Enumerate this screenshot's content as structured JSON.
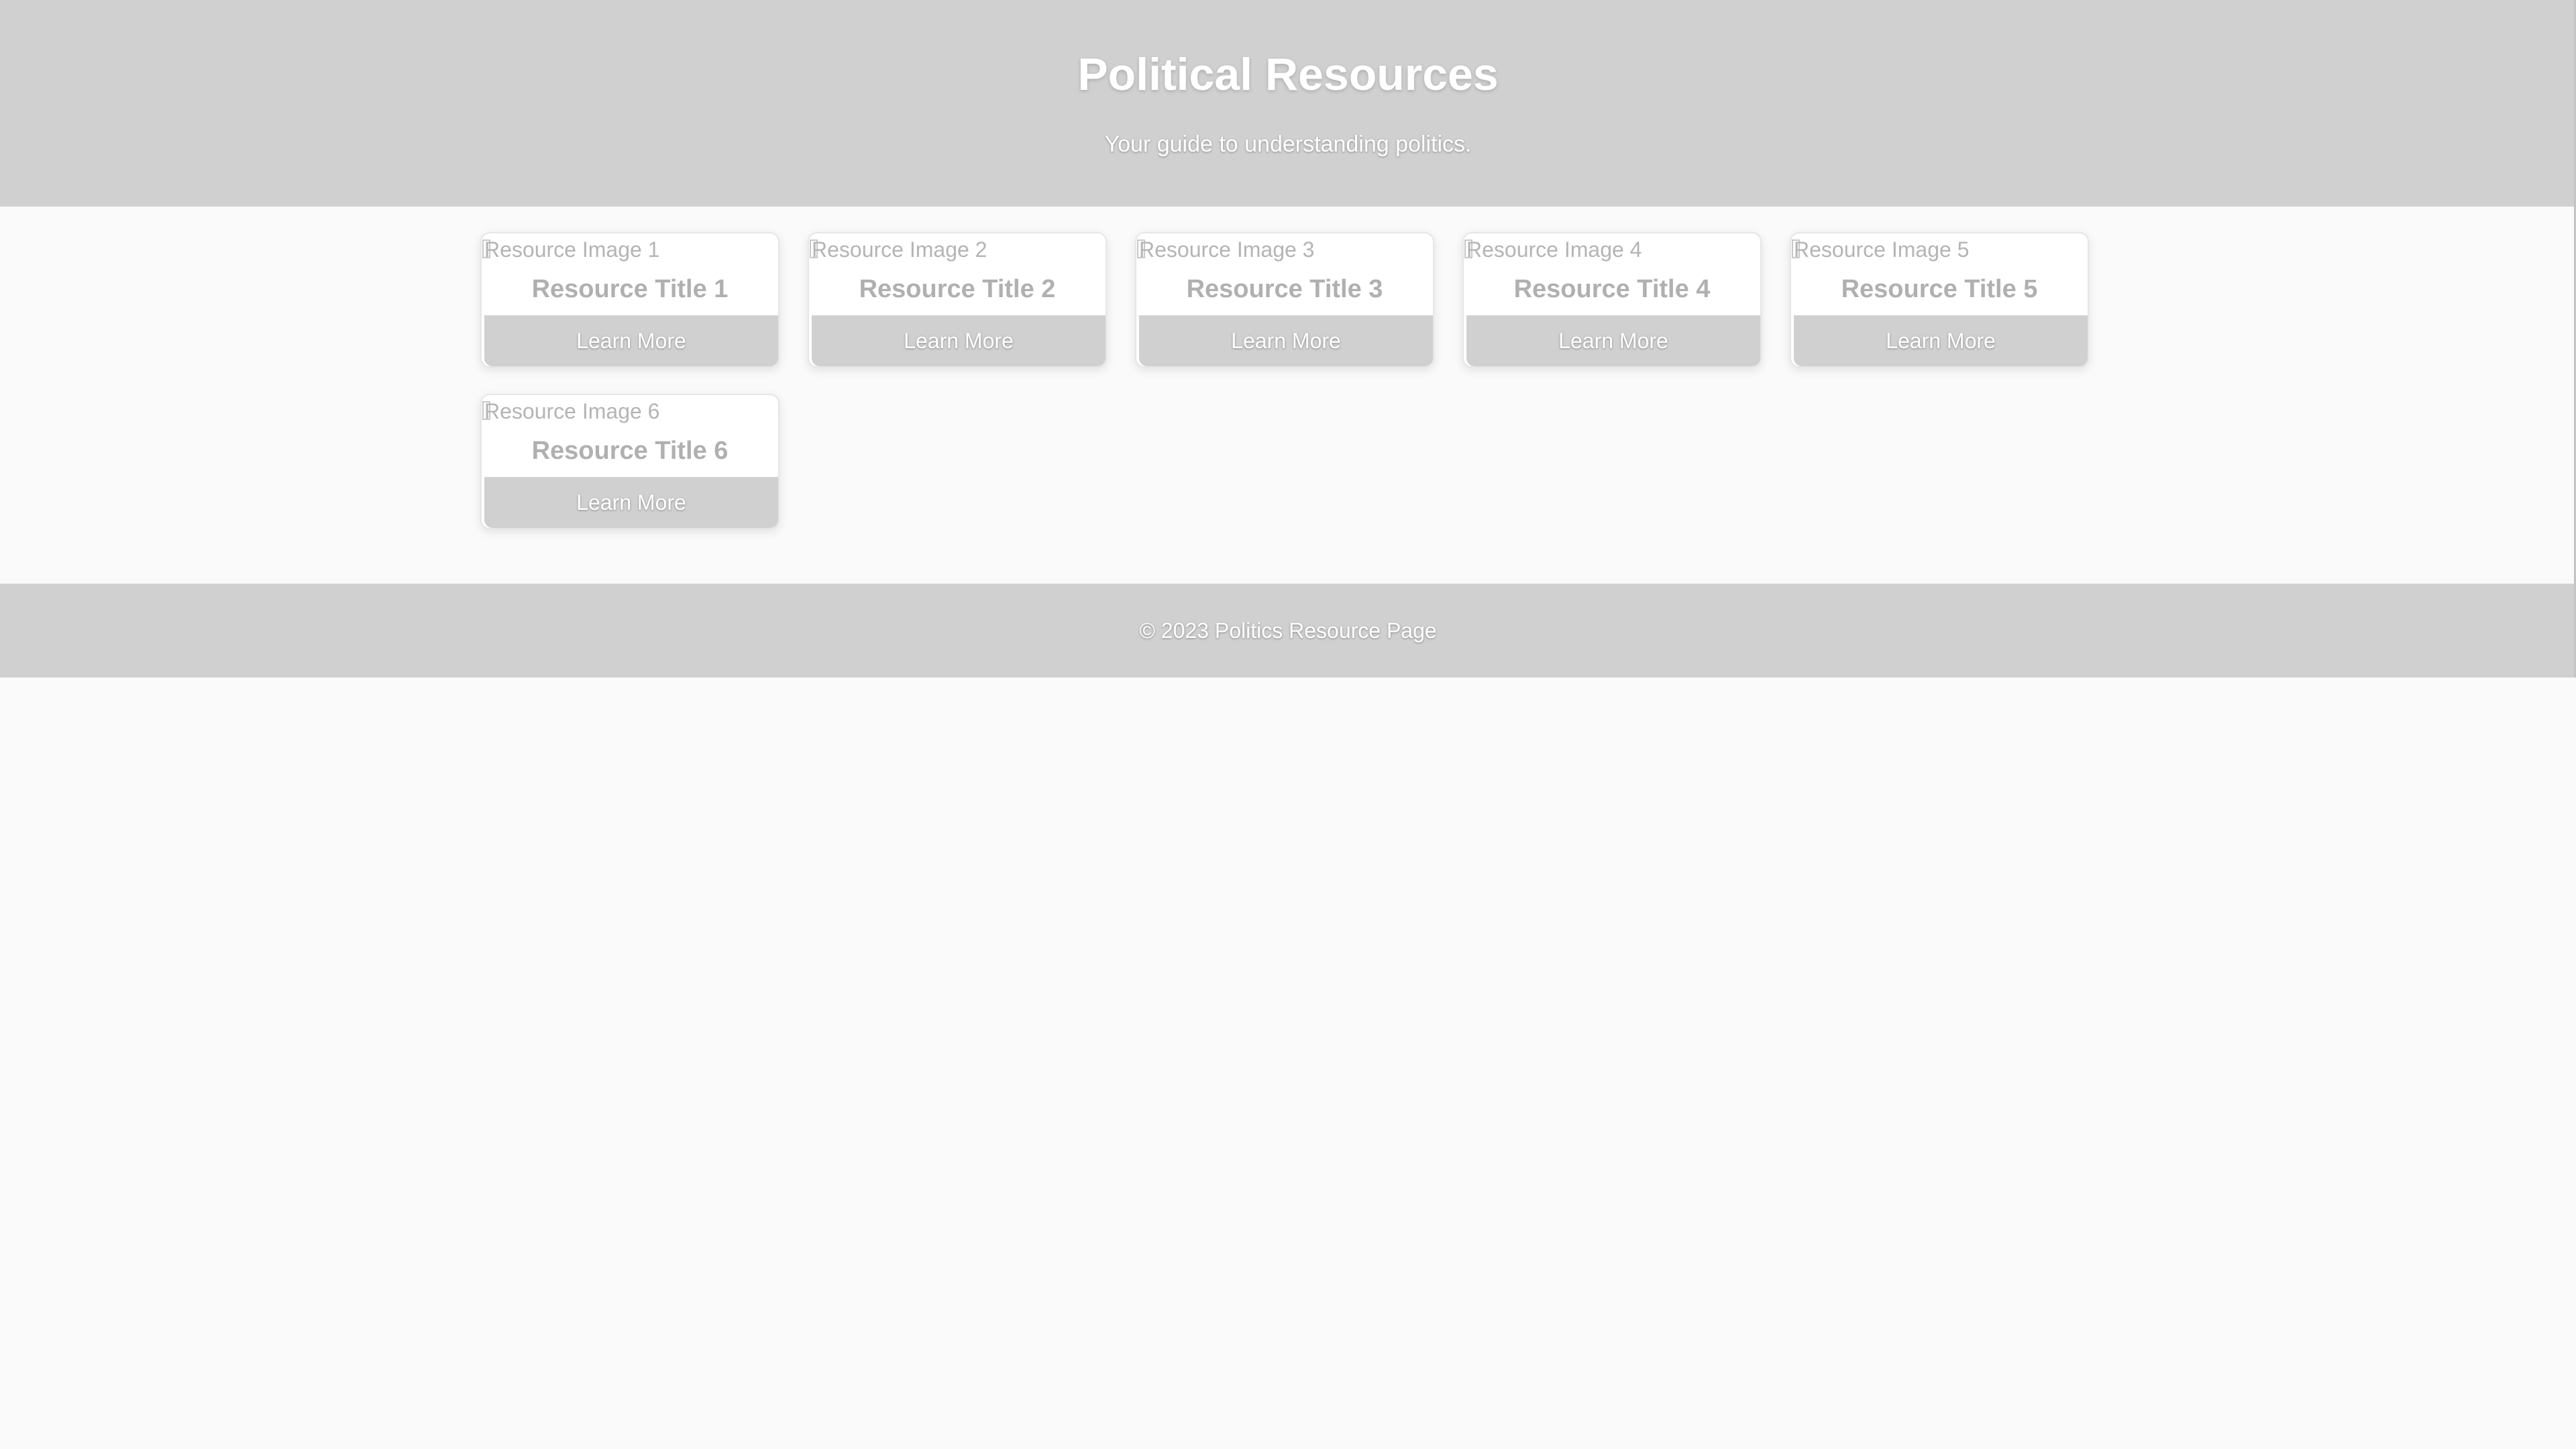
{
  "header": {
    "title": "Political Resources",
    "subtitle": "Your guide to understanding politics."
  },
  "resources": [
    {
      "image_alt": "Resource Image 1",
      "title": "Resource Title 1",
      "button_label": "Learn More"
    },
    {
      "image_alt": "Resource Image 2",
      "title": "Resource Title 2",
      "button_label": "Learn More"
    },
    {
      "image_alt": "Resource Image 3",
      "title": "Resource Title 3",
      "button_label": "Learn More"
    },
    {
      "image_alt": "Resource Image 4",
      "title": "Resource Title 4",
      "button_label": "Learn More"
    },
    {
      "image_alt": "Resource Image 5",
      "title": "Resource Title 5",
      "button_label": "Learn More"
    },
    {
      "image_alt": "Resource Image 6",
      "title": "Resource Title 6",
      "button_label": "Learn More"
    }
  ],
  "footer": {
    "text": "© 2023 Politics Resource Page"
  },
  "icons": {
    "broken_image": "broken-image-icon"
  },
  "colors": {
    "header_bg": "#d0d0d0",
    "page_bg": "#fafafa",
    "button_bg": "#d0d0d0",
    "title_text": "#b0b0b0"
  }
}
